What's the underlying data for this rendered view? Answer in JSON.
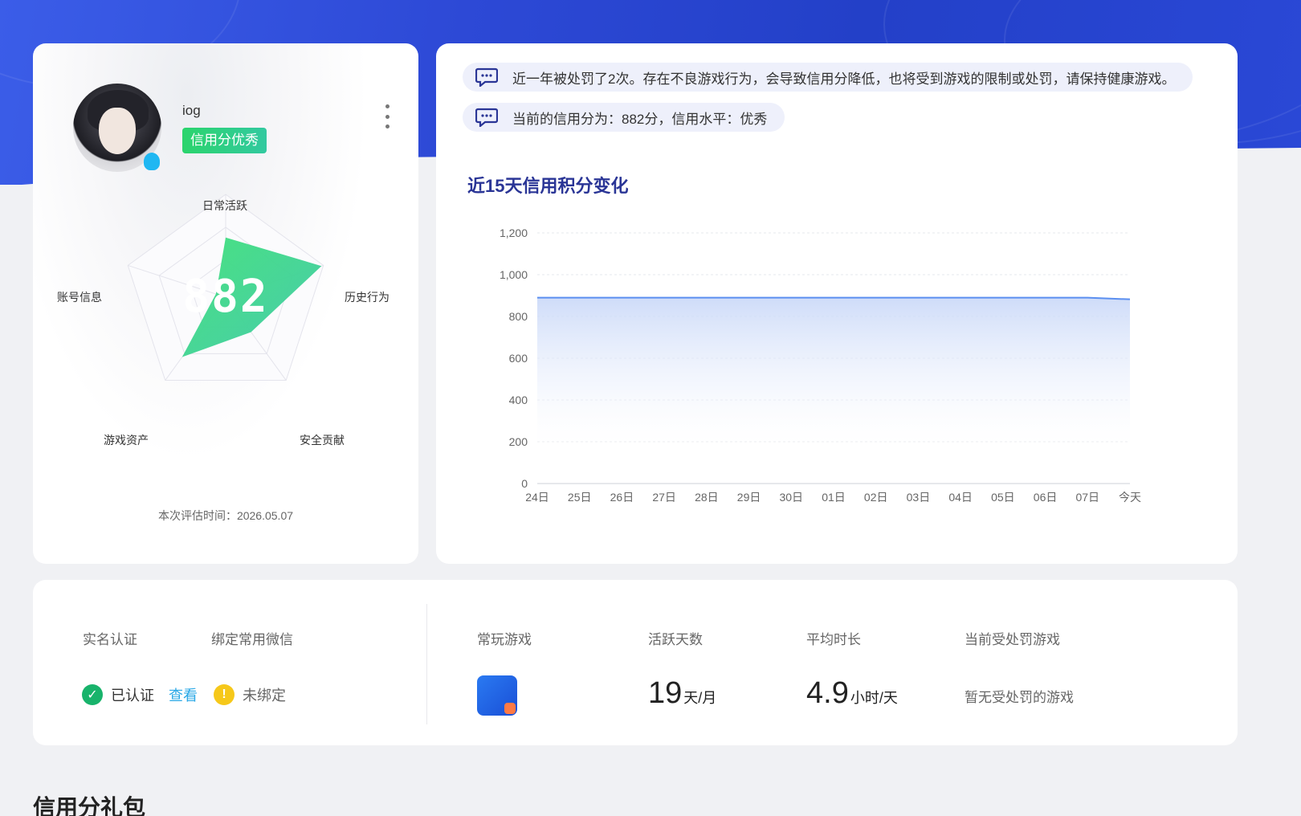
{
  "profile": {
    "username": "iog",
    "credit_badge": "信用分优秀",
    "score": "882",
    "eval_time": "本次评估时间：2026.05.07",
    "radar_labels": {
      "daily_active": "日常活跃",
      "history": "历史行为",
      "safety": "安全贡献",
      "assets": "游戏资产",
      "account": "账号信息"
    },
    "radar_values": {
      "daily_active": 0.58,
      "history": 0.98,
      "safety": 0.42,
      "assets": 0.72,
      "account": 0.1
    },
    "radar_color": "#3fd98a"
  },
  "notices": [
    "近一年被处罚了2次。存在不良游戏行为，会导致信用分降低，也将受到游戏的限制或处罚，请保持健康游戏。",
    "当前的信用分为：882分，信用水平：优秀"
  ],
  "chart_data": {
    "type": "area",
    "title": "近15天信用积分变化",
    "categories": [
      "24日",
      "25日",
      "26日",
      "27日",
      "28日",
      "29日",
      "30日",
      "01日",
      "02日",
      "03日",
      "04日",
      "05日",
      "06日",
      "07日",
      "今天"
    ],
    "series": [
      {
        "values": [
          890,
          890,
          890,
          890,
          890,
          890,
          890,
          890,
          890,
          890,
          890,
          890,
          890,
          890,
          882
        ]
      }
    ],
    "yticks": [
      "0",
      "200",
      "400",
      "600",
      "800",
      "1,000",
      "1,200"
    ],
    "ylim": [
      0,
      1200
    ],
    "grid": true,
    "line_color": "#5b8ff0"
  },
  "stats": {
    "labels": {
      "real_name": "实名认证",
      "wechat": "绑定常用微信",
      "frequent_game": "常玩游戏",
      "active_days": "活跃天数",
      "avg_time": "平均时长",
      "punished_game": "当前受处罚游戏"
    },
    "verified": "已认证",
    "view": "查看",
    "unbound": "未绑定",
    "active_days_value": "19",
    "active_days_unit": "天/月",
    "avg_time_value": "4.9",
    "avg_time_unit": "小时/天",
    "no_punish": "暂无受处罚的游戏"
  },
  "section_title": "信用分礼包"
}
